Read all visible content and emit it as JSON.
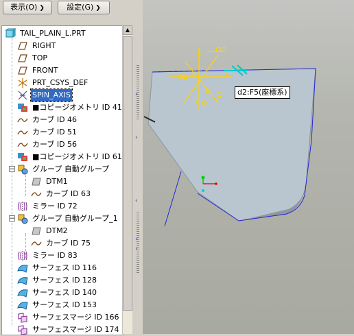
{
  "toolbar": {
    "display_label": "表示(O)",
    "settings_label": "設定(G)"
  },
  "tree": {
    "root_label": "TAIL_PLAIN_L.PRT",
    "items": [
      {
        "label": "RIGHT",
        "icon": "datum-plane-icon"
      },
      {
        "label": "TOP",
        "icon": "datum-plane-icon"
      },
      {
        "label": "FRONT",
        "icon": "datum-plane-icon"
      },
      {
        "label": "PRT_CSYS_DEF",
        "icon": "csys-icon"
      },
      {
        "label": "SPIN_AXIS",
        "icon": "axis-icon",
        "selected": true
      },
      {
        "label": "■コピージオメトリ ID 41",
        "icon": "copy-geometry-icon"
      },
      {
        "label": "カーブ ID 46",
        "icon": "curve-icon"
      },
      {
        "label": "カーブ ID 51",
        "icon": "curve-icon"
      },
      {
        "label": "カーブ ID 56",
        "icon": "curve-icon"
      },
      {
        "label": "■コピージオメトリ ID 61",
        "icon": "copy-geometry-icon"
      },
      {
        "label": "グループ 自動グループ",
        "icon": "group-icon",
        "expand": "−"
      },
      {
        "label": "DTM1",
        "icon": "datum-plane-gray-icon",
        "indent": 1
      },
      {
        "label": "カーブ ID 63",
        "icon": "curve-icon",
        "indent": 1
      },
      {
        "label": "ミラー ID 72",
        "icon": "mirror-icon"
      },
      {
        "label": "グループ 自動グループ_1",
        "icon": "group-icon",
        "expand": "−"
      },
      {
        "label": "DTM2",
        "icon": "datum-plane-gray-icon",
        "indent": 1
      },
      {
        "label": "カーブ ID 75",
        "icon": "curve-icon",
        "indent": 1
      },
      {
        "label": "ミラー ID 83",
        "icon": "mirror-icon"
      },
      {
        "label": "サーフェス ID 116",
        "icon": "surface-icon"
      },
      {
        "label": "サーフェス ID 128",
        "icon": "surface-icon"
      },
      {
        "label": "サーフェス ID 140",
        "icon": "surface-icon"
      },
      {
        "label": "サーフェス ID 153",
        "icon": "surface-icon"
      },
      {
        "label": "サーフェスマージ ID 166",
        "icon": "merge-icon"
      },
      {
        "label": "サーフェスマージ ID 174",
        "icon": "merge-icon"
      }
    ]
  },
  "viewport": {
    "tooltip": "d2:F5(座標系)"
  },
  "colors": {
    "selection": "#316ac5",
    "csys_yellow": "#ffd800",
    "axis_cyan": "#00c8c8",
    "edge_blue": "#2020d0",
    "surface": "#b8c4ce"
  }
}
